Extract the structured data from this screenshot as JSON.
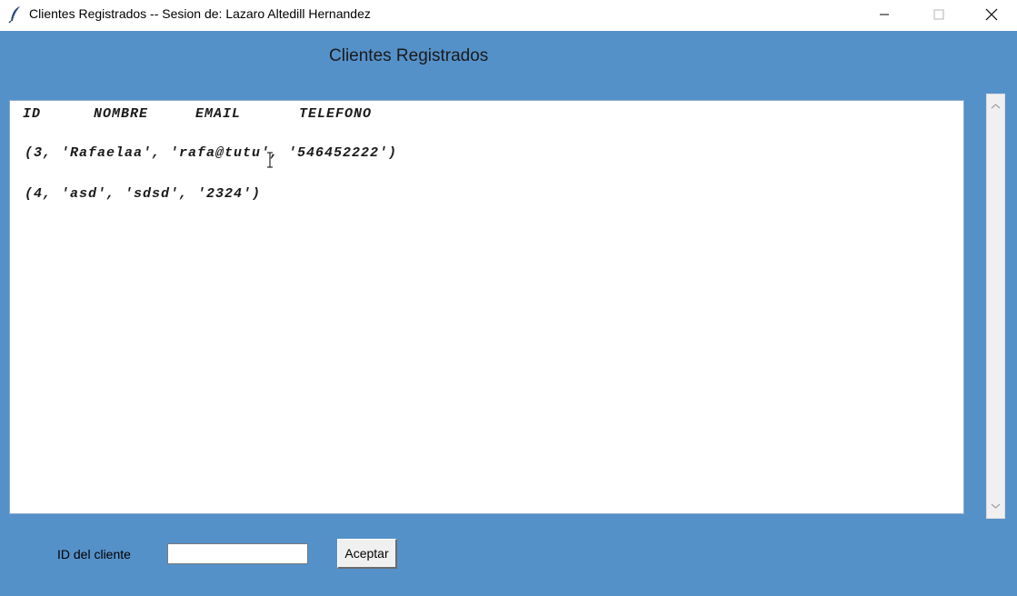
{
  "window": {
    "title": "Clientes Registrados -- Sesion de: Lazaro Altedill Hernandez",
    "icon": "feather-icon",
    "controls": [
      "minimize-icon",
      "maximize-icon",
      "close-icon"
    ]
  },
  "main": {
    "heading": "Clientes Registrados",
    "table": {
      "columns": [
        "ID",
        "NOMBRE",
        "EMAIL",
        "TELEFONO"
      ],
      "rows": [
        "(3, 'Rafaelaa', 'rafa@tutu', '546452222')",
        "(4, 'asd', 'sdsd', '2324')"
      ]
    }
  },
  "form": {
    "id_label": "ID del cliente",
    "id_value": "",
    "accept_label": "Aceptar"
  },
  "colors": {
    "background": "#5591c9",
    "titlebar": "#ffffff",
    "textbox": "#ffffff"
  }
}
